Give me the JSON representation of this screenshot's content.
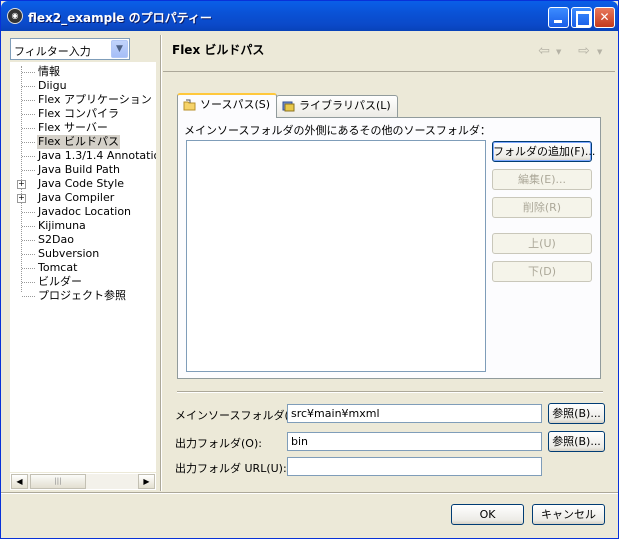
{
  "window": {
    "title": "flex2_example のプロパティー",
    "app_icon": "eclipse-icon"
  },
  "filter": {
    "value": "フィルター入力"
  },
  "tree": {
    "items": [
      {
        "label": "情報",
        "expandable": false
      },
      {
        "label": "Diigu",
        "expandable": false
      },
      {
        "label": "Flex アプリケーション",
        "expandable": false
      },
      {
        "label": "Flex コンパイラ",
        "expandable": false
      },
      {
        "label": "Flex サーバー",
        "expandable": false
      },
      {
        "label": "Flex ビルドパス",
        "expandable": false,
        "selected": true
      },
      {
        "label": "Java 1.3/1.4 Annotatior",
        "expandable": false
      },
      {
        "label": "Java Build Path",
        "expandable": false
      },
      {
        "label": "Java Code Style",
        "expandable": true
      },
      {
        "label": "Java Compiler",
        "expandable": true
      },
      {
        "label": "Javadoc Location",
        "expandable": false
      },
      {
        "label": "Kijimuna",
        "expandable": false
      },
      {
        "label": "S2Dao",
        "expandable": false
      },
      {
        "label": "Subversion",
        "expandable": false
      },
      {
        "label": "Tomcat",
        "expandable": false
      },
      {
        "label": "ビルダー",
        "expandable": false
      },
      {
        "label": "プロジェクト参照",
        "expandable": false
      }
    ]
  },
  "page": {
    "title": "Flex ビルドパス",
    "tabs": [
      {
        "label": "ソースパス(S)",
        "icon": "folder-icon",
        "active": true
      },
      {
        "label": "ライブラリパス(L)",
        "icon": "library-icon",
        "active": false
      }
    ],
    "source_list_label": "メインソースフォルダの外側にあるその他のソースフォルダ：",
    "buttons": {
      "add_folder": "フォルダの追加(F)...",
      "edit": "編集(E)...",
      "remove": "削除(R)",
      "up": "上(U)",
      "down": "下(D)"
    },
    "fields": {
      "main_source_label": "メインソースフォルダ(S):",
      "main_source_value": "src¥main¥mxml",
      "output_label": "出力フォルダ(O):",
      "output_value": "bin",
      "output_url_label": "出力フォルダ URL(U):",
      "output_url_value": "",
      "browse1": "参照(B)...",
      "browse2": "参照(B)..."
    }
  },
  "dialog": {
    "ok": "OK",
    "cancel": "キャンセル"
  }
}
